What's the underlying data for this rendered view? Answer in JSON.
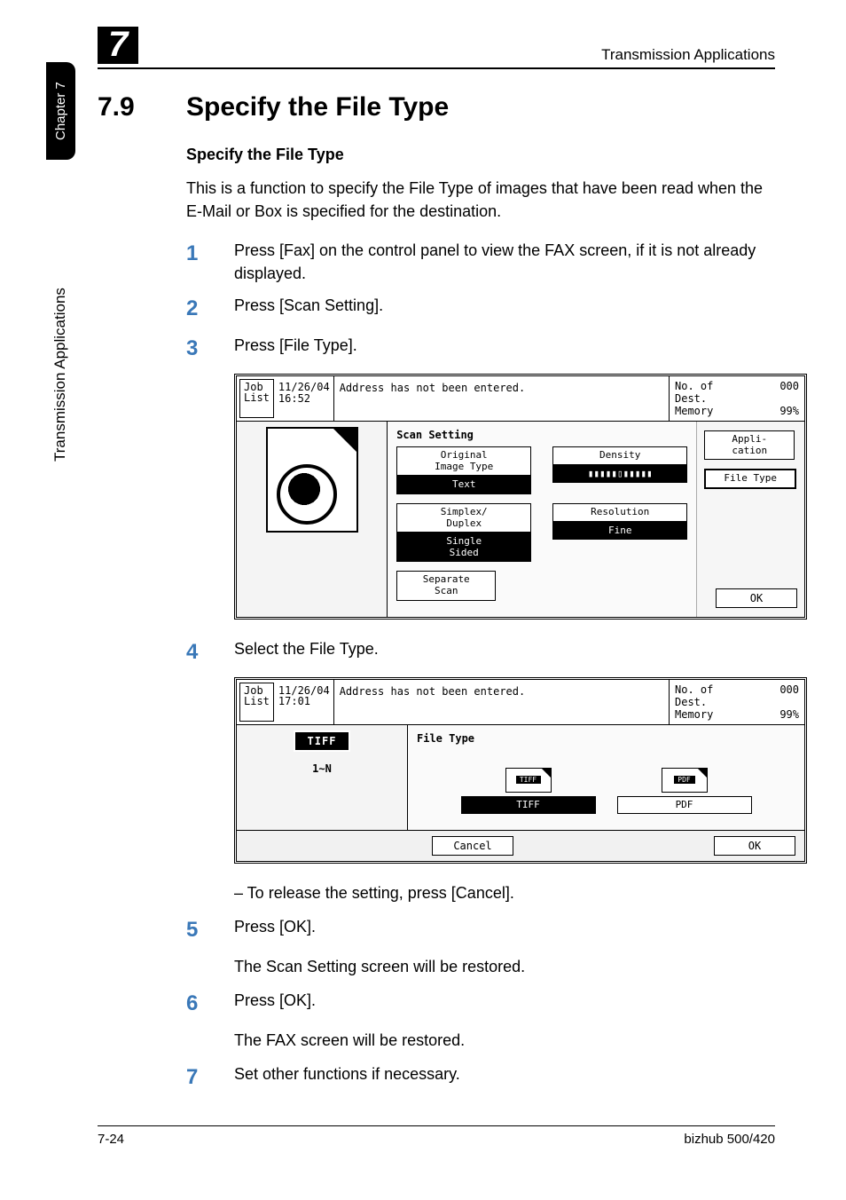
{
  "sidebar": {
    "chapter_label": "Chapter 7",
    "section_label": "Transmission Applications"
  },
  "header": {
    "chapter_number": "7",
    "running_title": "Transmission Applications"
  },
  "section": {
    "number": "7.9",
    "title": "Specify the File Type",
    "subheading": "Specify the File Type"
  },
  "intro": "This is a function to specify the File Type of images that have been read when the E-Mail or Box is specified for the destination.",
  "steps": [
    {
      "n": "1",
      "text": "Press [Fax] on the control panel to view the FAX screen, if it is not already displayed."
    },
    {
      "n": "2",
      "text": "Press [Scan Setting]."
    },
    {
      "n": "3",
      "text": "Press [File Type]."
    },
    {
      "n": "4",
      "text": "Select the File Type."
    },
    {
      "n": "5",
      "text": "Press [OK]."
    },
    {
      "n": "6",
      "text": "Press [OK]."
    },
    {
      "n": "7",
      "text": "Set other functions if necessary."
    }
  ],
  "sub4": "–   To release the setting, press [Cancel].",
  "after5": "The Scan Setting screen will be restored.",
  "after6": "The FAX screen will be restored.",
  "lcd1": {
    "joblist": "Job\nList",
    "datetime": "11/26/04\n16:52",
    "message": "Address has not been entered.",
    "destlabel": "No. of\nDest.",
    "destval": "000",
    "memlabel": "Memory",
    "memval": "99%",
    "panel_title": "Scan Setting",
    "orig": "Original\nImage Type",
    "orig_val": "Text",
    "density": "Density",
    "density_val": "▮▮▮▮▮▯▮▮▮▮▮",
    "duplex": "Simplex/\nDuplex",
    "duplex_val": "Single\nSided",
    "resolution": "Resolution",
    "resolution_val": "Fine",
    "separate": "Separate\nScan",
    "app": "Appli-\ncation",
    "filetype": "File Type",
    "ok": "OK"
  },
  "lcd2": {
    "joblist": "Job\nList",
    "datetime": "11/26/04\n17:01",
    "message": "Address has not been entered.",
    "destlabel": "No. of\nDest.",
    "destval": "000",
    "memlabel": "Memory",
    "memval": "99%",
    "panel_title": "File Type",
    "left_badge": "TIFF",
    "left_range": "1∼N",
    "tiff_small": "TIFF",
    "pdf_small": "PDF",
    "tiff_btn": "TIFF",
    "pdf_btn": "PDF",
    "cancel": "Cancel",
    "ok": "OK"
  },
  "footer": {
    "page": "7-24",
    "product": "bizhub 500/420"
  }
}
